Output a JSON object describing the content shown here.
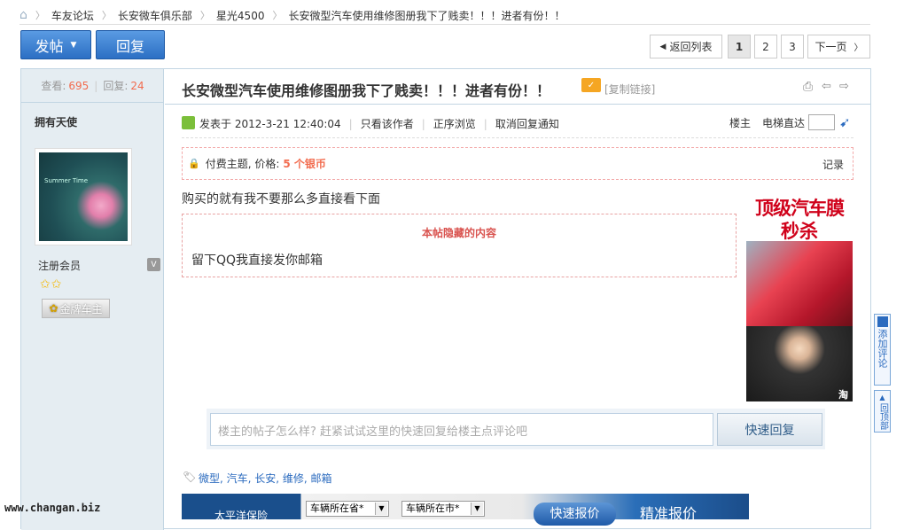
{
  "breadcrumb": {
    "items": [
      "车友论坛",
      "长安微车俱乐部",
      "星光4500",
      "长安微型汽车使用维修图册我下了贱卖！！！进者有份！！"
    ]
  },
  "toolbar": {
    "post_label": "发帖",
    "reply_label": "回复"
  },
  "pager": {
    "back_label": "返回列表",
    "pages": [
      "1",
      "2",
      "3"
    ],
    "current_page": "1",
    "next_label": "下一页"
  },
  "stats": {
    "views_label": "查看:",
    "views": "695",
    "replies_label": "回复:",
    "replies": "24"
  },
  "thread": {
    "title": "长安微型汽车使用维修图册我下了贱卖！！！进者有份！！",
    "copy_link_label": "[复制链接]"
  },
  "author": {
    "name": "拥有天使",
    "avatar_text": "Summer Time",
    "role": "注册会员",
    "role_badge": "V",
    "stars": "✩✩",
    "medal": "金牌车主"
  },
  "post": {
    "posted_label": "发表于 2012-3-21 12:40:04",
    "only_author": "只看该作者",
    "order_browse": "正序浏览",
    "cancel_notify": "取消回复通知",
    "floor_label": "楼主",
    "floor_jump_label": "电梯直达",
    "paid_label": "付费主题, 价格:",
    "price": "5 个银币",
    "record_label": "记录",
    "body": "购买的就有我不要那么多直接看下面",
    "hidden_title": "本帖隐藏的内容",
    "hidden_body": "留下QQ我直接发你邮箱"
  },
  "ad": {
    "line1": "顶级汽车膜",
    "line2": "秒杀",
    "badge": "淘"
  },
  "floaters": {
    "add_comment": "添加评论",
    "back_top": "回顶部"
  },
  "quick_reply": {
    "placeholder": "楼主的帖子怎么样? 赶紧试试这里的快速回复给楼主点评论吧",
    "button": "快速回复"
  },
  "tags": {
    "text": "微型, 汽车, 长安, 维修, 邮箱"
  },
  "banner": {
    "logo_text": "太平洋保险",
    "province_select": "车辆所在省*",
    "city_select": "车辆所在市*",
    "quote_button": "快速报价",
    "precise_label": "精准报价"
  },
  "watermark": "www.changan.biz",
  "colors": {
    "accent_blue": "#2c6fc4",
    "count_red": "#f26c4f",
    "ad_red": "#d0021b",
    "frame_border": "#c2d5e3"
  }
}
